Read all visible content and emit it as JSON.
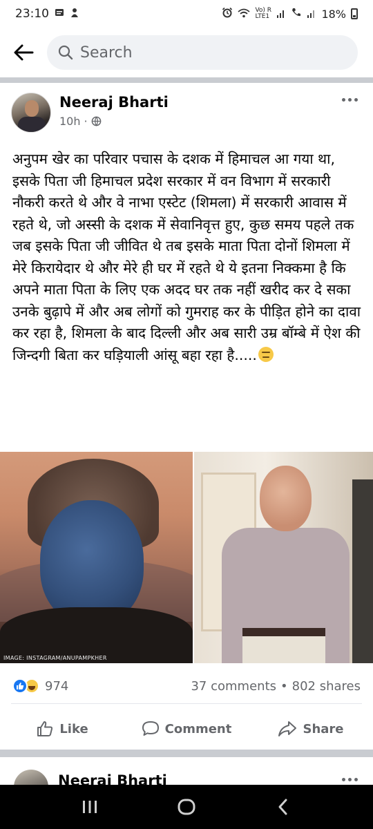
{
  "status_bar": {
    "time": "23:10",
    "network_label": "Vo) R LTE1",
    "battery": "18%"
  },
  "search": {
    "placeholder": "Search"
  },
  "post": {
    "author": "Neeraj Bharti",
    "time_ago": "10h",
    "separator": "·",
    "privacy_icon": "globe-icon",
    "text": "अनुपम खेर का परिवार पचास के दशक में हिमाचल आ गया था, इसके पिता जी हिमाचल प्रदेश सरकार में वन विभाग में सरकारी नौकरी करते थे और वे नाभा एस्टेट (शिमला) में सरकारी आवास में रहते थे, जो अस्सी के दशक में सेवानिवृत्त हुए, कुछ समय पहले तक जब इसके पिता जी जीवित थे तब इसके माता पिता दोनों शिमला में मेरे किरायेदार थे और मेरे ही घर में रहते थे ये इतना निक्कमा है कि अपने माता पिता के लिए एक अदद घर तक नहीं खरीद कर दे सका उनके बुढ़ापे में और अब लोगों को गुमराह कर के पीड़ित होने का दावा कर रहा है, शिमला के बाद दिल्ली और अब सारी उम्र बॉम्बे में ऐश की जिन्दगी बिता कर घड़ियाली आंसू बहा रहा है.....",
    "image_caption": "IMAGE: INSTAGRAM/ANUPAMPKHER",
    "reactions": {
      "icons": [
        "like-icon",
        "haha-icon"
      ],
      "count": "974"
    },
    "comments": "37 comments",
    "bullet": "•",
    "shares": "802 shares",
    "actions": {
      "like": "Like",
      "comment": "Comment",
      "share": "Share"
    }
  },
  "next_post": {
    "author": "Neeraj Bharti"
  },
  "colors": {
    "facebook_blue": "#1877f2",
    "secondary_text": "#65676b",
    "search_bg": "#f0f2f5",
    "divider_band": "#c9ccd1"
  }
}
